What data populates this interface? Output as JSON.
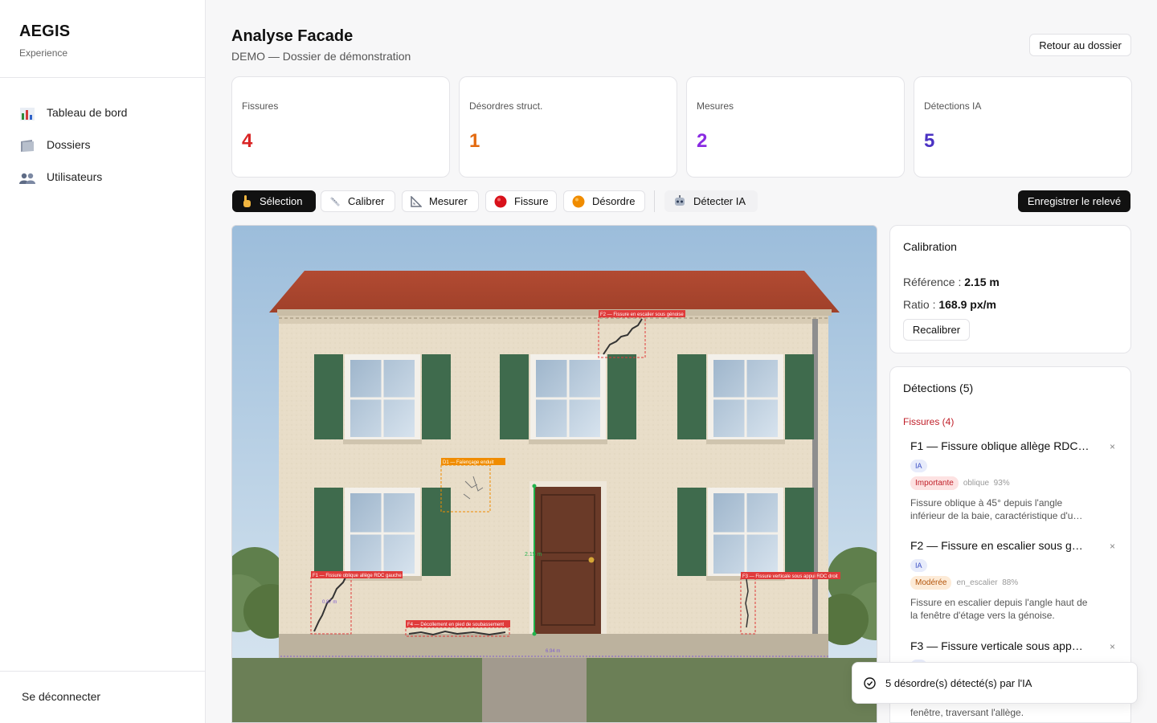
{
  "app": {
    "name": "AEGIS",
    "subtitle": "Experience"
  },
  "sidebar": {
    "items": [
      {
        "label": "Tableau de bord",
        "icon": "bar-chart-icon"
      },
      {
        "label": "Dossiers",
        "icon": "folder-icon"
      },
      {
        "label": "Utilisateurs",
        "icon": "users-icon"
      }
    ],
    "logout": "Se déconnecter"
  },
  "header": {
    "title": "Analyse Facade",
    "subtitle": "DEMO — Dossier de démonstration",
    "back_label": "Retour au dossier"
  },
  "stats": [
    {
      "label": "Fissures",
      "value": "4",
      "color": "#d92525"
    },
    {
      "label": "Désordres struct.",
      "value": "1",
      "color": "#e36a10"
    },
    {
      "label": "Mesures",
      "value": "2",
      "color": "#8a2be2"
    },
    {
      "label": "Détections IA",
      "value": "5",
      "color": "#4b32c3"
    }
  ],
  "toolbar": {
    "selection": "Sélection",
    "calibrer": "Calibrer",
    "mesurer": "Mesurer",
    "fissure": "Fissure",
    "desordre": "Désordre",
    "detecter": "Détecter IA",
    "save": "Enregistrer le relevé"
  },
  "canvas": {
    "annotations": {
      "f1": "F1 — Fissure oblique allège RDC gauche",
      "f2": "F2 — Fissure en escalier sous génoise",
      "f3": "F3 — Fissure verticale sous appui RDC droit",
      "f4": "F4 — Décollement en pied de soubassement",
      "d1": "D1 — Faïençage enduit",
      "ia": "IA"
    },
    "measures": {
      "door_height": "2.15 m",
      "facade_width": "6.94 m",
      "f1_length": "0.87 m"
    }
  },
  "calibration": {
    "title": "Calibration",
    "reference_label": "Référence :",
    "reference_value": "2.15 m",
    "ratio_label": "Ratio :",
    "ratio_value": "168.9 px/m",
    "recalibrate": "Recalibrer"
  },
  "detections": {
    "title": "Détections (5)",
    "group_label": "Fissures (4)",
    "items": [
      {
        "title": "F1 — Fissure oblique allège RDC…",
        "badge": "IA",
        "severity": "Importante",
        "sev_bg": "#fde2e2",
        "sev_color": "#c0202a",
        "type": "oblique",
        "confidence": "93%",
        "description": "Fissure oblique à 45° depuis l'angle inférieur de la baie, caractéristique d'u…"
      },
      {
        "title": "F2 — Fissure en escalier sous g…",
        "badge": "IA",
        "severity": "Modérée",
        "sev_bg": "#fdebd7",
        "sev_color": "#b4560c",
        "type": "en_escalier",
        "confidence": "88%",
        "description": "Fissure en escalier depuis l'angle haut de la fenêtre d'étage vers la génoise."
      },
      {
        "title": "F3 — Fissure verticale sous app…",
        "badge": "IA"
      }
    ],
    "tail_text": "fenêtre, traversant l'allège.",
    "close": "×"
  },
  "toast": {
    "text": "5 désordre(s) détecté(s) par l'IA"
  }
}
